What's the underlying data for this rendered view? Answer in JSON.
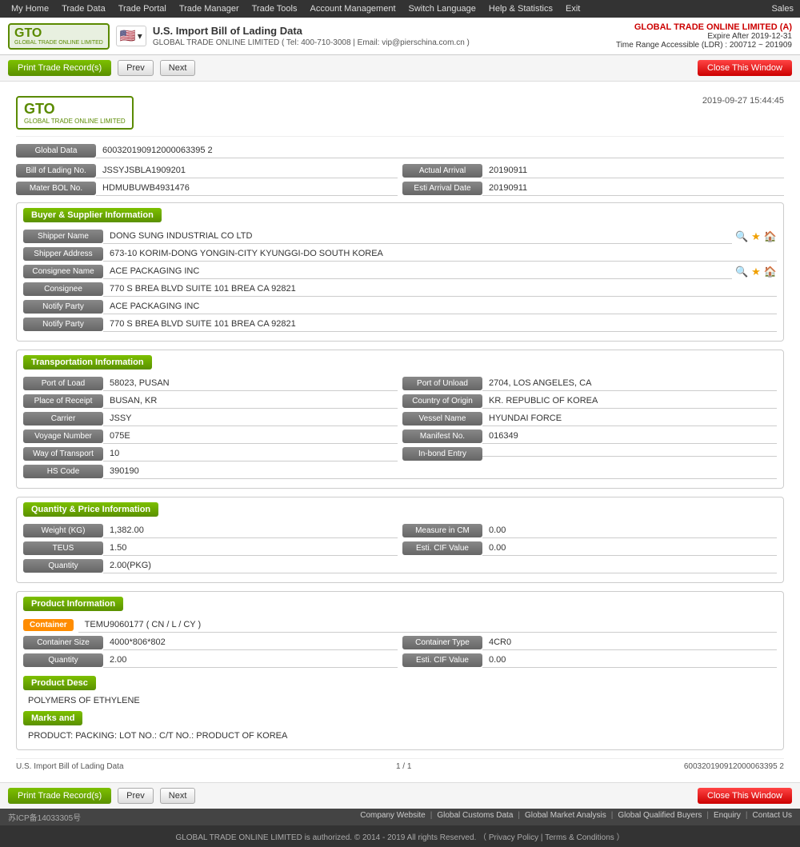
{
  "topnav": {
    "items": [
      "My Home",
      "Trade Data",
      "Trade Portal",
      "Trade Manager",
      "Trade Tools",
      "Account Management",
      "Switch Language",
      "Help & Statistics",
      "Exit"
    ],
    "right": "Sales"
  },
  "header": {
    "logo_text": "GTO",
    "logo_sub": "GLOBAL TRADE ONLINE LIMITED",
    "flag_emoji": "🇺🇸",
    "title": "U.S. Import Bill of Lading Data",
    "contact": "GLOBAL TRADE ONLINE LIMITED ( Tel: 400-710-3008 | Email: vip@pierschina.com.cn )",
    "company": "GLOBAL TRADE ONLINE LIMITED (A)",
    "expire": "Expire After 2019-12-31",
    "ldr": "Time Range Accessible (LDR) : 200712 ~ 201909"
  },
  "toolbar": {
    "print_label": "Print Trade Record(s)",
    "prev_label": "Prev",
    "next_label": "Next",
    "close_label": "Close This Window"
  },
  "record": {
    "datetime": "2019-09-27 15:44:45",
    "global_data_label": "Global Data",
    "global_data_value": "600320190912000063395 2",
    "bill_of_lading_label": "Bill of Lading No.",
    "bill_of_lading_value": "JSSYJSBLA1909201",
    "actual_arrival_label": "Actual Arrival",
    "actual_arrival_value": "20190911",
    "mater_bol_label": "Mater BOL No.",
    "mater_bol_value": "HDMUBUWB4931476",
    "esti_arrival_label": "Esti Arrival Date",
    "esti_arrival_value": "20190911"
  },
  "buyer_supplier": {
    "section_title": "Buyer & Supplier Information",
    "shipper_name_label": "Shipper Name",
    "shipper_name_value": "DONG SUNG INDUSTRIAL CO LTD",
    "shipper_address_label": "Shipper Address",
    "shipper_address_value": "673-10 KORIM-DONG YONGIN-CITY KYUNGGI-DO SOUTH KOREA",
    "consignee_name_label": "Consignee Name",
    "consignee_name_value": "ACE PACKAGING INC",
    "consignee_label": "Consignee",
    "consignee_value": "770 S BREA BLVD SUITE 101 BREA CA 92821",
    "notify_party_label": "Notify Party",
    "notify_party_value": "ACE PACKAGING INC",
    "notify_party2_value": "770 S BREA BLVD SUITE 101 BREA CA 92821"
  },
  "transportation": {
    "section_title": "Transportation Information",
    "port_of_load_label": "Port of Load",
    "port_of_load_value": "58023, PUSAN",
    "port_of_unload_label": "Port of Unload",
    "port_of_unload_value": "2704, LOS ANGELES, CA",
    "place_of_receipt_label": "Place of Receipt",
    "place_of_receipt_value": "BUSAN, KR",
    "country_of_origin_label": "Country of Origin",
    "country_of_origin_value": "KR. REPUBLIC OF KOREA",
    "carrier_label": "Carrier",
    "carrier_value": "JSSY",
    "vessel_name_label": "Vessel Name",
    "vessel_name_value": "HYUNDAI FORCE",
    "voyage_number_label": "Voyage Number",
    "voyage_number_value": "075E",
    "manifest_no_label": "Manifest No.",
    "manifest_no_value": "016349",
    "way_of_transport_label": "Way of Transport",
    "way_of_transport_value": "10",
    "in_bond_entry_label": "In-bond Entry",
    "in_bond_entry_value": "",
    "hs_code_label": "HS Code",
    "hs_code_value": "390190"
  },
  "quantity_price": {
    "section_title": "Quantity & Price Information",
    "weight_label": "Weight (KG)",
    "weight_value": "1,382.00",
    "measure_cm_label": "Measure in CM",
    "measure_cm_value": "0.00",
    "teus_label": "TEUS",
    "teus_value": "1.50",
    "esti_cif_label": "Esti. CIF Value",
    "esti_cif_value": "0.00",
    "quantity_label": "Quantity",
    "quantity_value": "2.00(PKG)"
  },
  "product_info": {
    "section_title": "Product Information",
    "container_label": "Container",
    "container_value": "TEMU9060177 ( CN / L / CY )",
    "container_size_label": "Container Size",
    "container_size_value": "4000*806*802",
    "container_type_label": "Container Type",
    "container_type_value": "4CR0",
    "quantity_label": "Quantity",
    "quantity_value": "2.00",
    "esti_cif_label": "Esti. CIF Value",
    "esti_cif_value": "0.00",
    "product_desc_label": "Product Desc",
    "product_desc_value": "POLYMERS OF ETHYLENE",
    "marks_label": "Marks and",
    "marks_value": "PRODUCT: PACKING: LOT NO.: C/T NO.: PRODUCT OF KOREA"
  },
  "record_footer": {
    "title": "U.S. Import Bill of Lading Data",
    "page": "1 / 1",
    "id": "600320190912000063395 2"
  },
  "footer": {
    "icp": "苏ICP备14033305号",
    "links": [
      "Company Website",
      "Global Customs Data",
      "Global Market Analysis",
      "Global Qualified Buyers",
      "Enquiry",
      "Contact Us"
    ],
    "copyright": "GLOBAL TRADE ONLINE LIMITED is authorized. © 2014 - 2019 All rights Reserved. （ Privacy Policy | Terms & Conditions ）"
  }
}
